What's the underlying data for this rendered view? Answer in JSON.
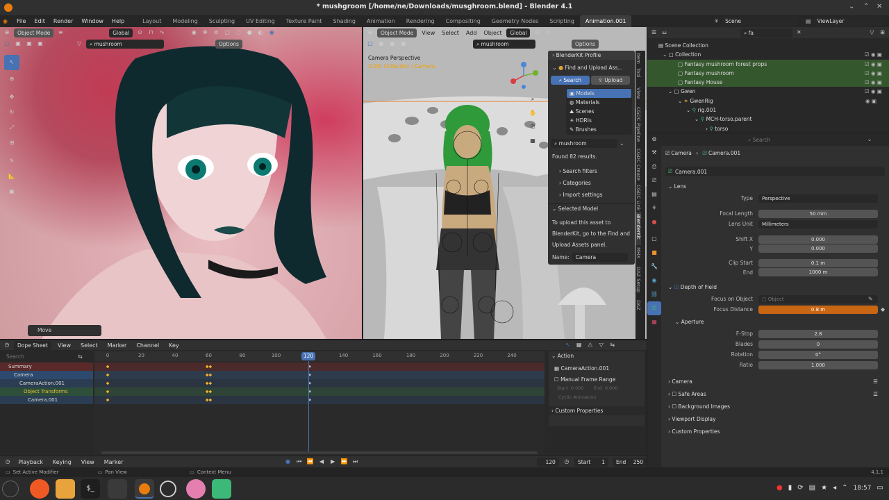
{
  "window": {
    "title": "* mushgroom [/home/ne/Downloads/musghroom.blend] - Blender 4.1"
  },
  "menu": [
    "File",
    "Edit",
    "Render",
    "Window",
    "Help"
  ],
  "workspaces": [
    "Layout",
    "Modeling",
    "Sculpting",
    "UV Editing",
    "Texture Paint",
    "Shading",
    "Animation",
    "Rendering",
    "Compositing",
    "Geometry Nodes",
    "Scripting",
    "Animation.001"
  ],
  "scene": {
    "label": "Scene",
    "view_layer": "ViewLayer"
  },
  "vp1": {
    "mode": "Object Mode",
    "transform": "Global",
    "search": "mushroom",
    "options": "Options",
    "operator": "Move"
  },
  "vp2": {
    "mode": "Object Mode",
    "menus": [
      "View",
      "Select",
      "Add",
      "Object"
    ],
    "transform": "Global",
    "search": "mushroom",
    "options": "Options",
    "cam_title": "Camera Perspective",
    "cam_sub": "(120) Collection | Camera"
  },
  "blenderkit": {
    "profile": "BlenderKit Profile",
    "find": "Find and Upload Ass...",
    "search_tab": "Search",
    "upload_tab": "Upload",
    "categories": [
      "Models",
      "Materials",
      "Scenes",
      "HDRIs",
      "Brushes"
    ],
    "query": "mushroom",
    "found": "Found 82 results.",
    "filters": [
      "Search filters",
      "Categories",
      "Import settings"
    ],
    "selected_model": "Selected Model",
    "info": [
      "To upload this asset to",
      "BlenderKit, go to the Find and",
      "Upload Assets panel."
    ],
    "name_label": "Name:",
    "name_value": "Camera"
  },
  "side_tabs": [
    "Item",
    "Tool",
    "View",
    "CGDC Pipeline",
    "CGDC Create",
    "CGDC Link",
    "BlenderKit",
    "MHX",
    "DAZ Setup",
    "DAZ"
  ],
  "dope": {
    "editor": "Dope Sheet",
    "menus": [
      "View",
      "Select",
      "Marker",
      "Channel",
      "Key"
    ],
    "search": "Search",
    "ticks": [
      "0",
      "20",
      "40",
      "60",
      "80",
      "100",
      "120",
      "140",
      "160",
      "180",
      "200",
      "220",
      "240"
    ],
    "current": "120",
    "channels": [
      "Summary",
      "Camera",
      "CameraAction.001",
      "Object Transforms",
      "Camera.001"
    ],
    "action": {
      "title": "Action",
      "name": "CameraAction.001",
      "manual": "Manual Frame Range",
      "start": "Start",
      "start_v": "0.000",
      "end": "End",
      "end_v": "0.000",
      "cyclic": "Cyclic Animation",
      "custom": "Custom Properties"
    }
  },
  "timeline": {
    "menus": [
      "Playback",
      "Keying",
      "View",
      "Marker"
    ],
    "frame": "120",
    "start_label": "Start",
    "start": "1",
    "end_label": "End",
    "end": "250"
  },
  "status": {
    "left": "Set Active Modifier",
    "mid": "Pan View",
    "right": "Context Menu",
    "version": "4.1.1"
  },
  "outliner": {
    "search": "fa",
    "items": [
      "Scene Collection",
      "Collection",
      "Fantasy mushroom forest props",
      "Fantasy mushroom",
      "Fantasy House",
      "Gwen",
      "GwenRig",
      "rig.001",
      "MCH-torso.parent",
      "torso"
    ]
  },
  "props": {
    "search": "Search",
    "breadcrumb1": "Camera",
    "breadcrumb2": "Camera.001",
    "datablock": "Camera.001",
    "lens": "Lens",
    "type_label": "Type",
    "type": "Perspective",
    "focal_label": "Focal Length",
    "focal": "50 mm",
    "unit_label": "Lens Unit",
    "unit": "Millimeters",
    "shiftx_label": "Shift X",
    "shiftx": "0.000",
    "y_label": "Y",
    "y": "0.000",
    "clip_start_label": "Clip Start",
    "clip_start": "0.1 m",
    "end_label": "End",
    "end": "1000 m",
    "dof": "Depth of Field",
    "focus_obj_label": "Focus on Object",
    "focus_obj": "Object",
    "focus_dist_label": "Focus Distance",
    "focus_dist": "0.8 m",
    "aperture": "Aperture",
    "fstop_label": "F-Stop",
    "fstop": "2.8",
    "blades_label": "Blades",
    "blades": "0",
    "rotation_label": "Rotation",
    "rotation": "0°",
    "ratio_label": "Ratio",
    "ratio": "1.000",
    "sections": [
      "Camera",
      "Safe Areas",
      "Background Images",
      "Viewport Display",
      "Custom Properties"
    ]
  },
  "tray": {
    "time": "18:57"
  },
  "colors": {
    "accent": "#4772b3",
    "selected_row": "#35572e",
    "orange": "#c86614",
    "keyframe": "#f0b12d"
  }
}
